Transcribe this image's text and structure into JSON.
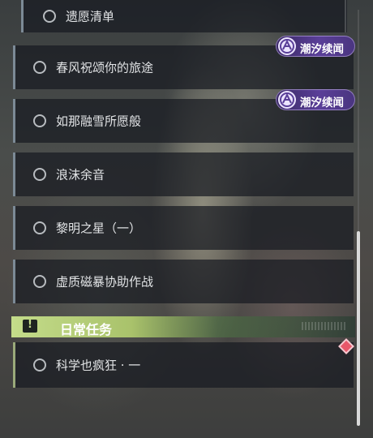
{
  "quests": [
    {
      "label": "遗愿清单"
    },
    {
      "label": "春风祝颂你的旅途"
    },
    {
      "label": "如那融雪所愿般"
    },
    {
      "label": "浪沫余音"
    },
    {
      "label": "黎明之星（一）"
    },
    {
      "label": "虚质磁暴协助作战"
    }
  ],
  "badges": [
    {
      "label": "潮汐续闻",
      "icon": "tidal-event-icon"
    },
    {
      "label": "潮汐续闻",
      "icon": "tidal-event-icon"
    }
  ],
  "daily_section": {
    "title": "日常任务",
    "icon_glyph": "!",
    "quests": [
      {
        "label": "科学也疯狂 · 一"
      }
    ]
  },
  "colors": {
    "section_accent": "#c4dc8a",
    "badge_purple": "#5a3f98",
    "new_marker": "#e8586a"
  }
}
